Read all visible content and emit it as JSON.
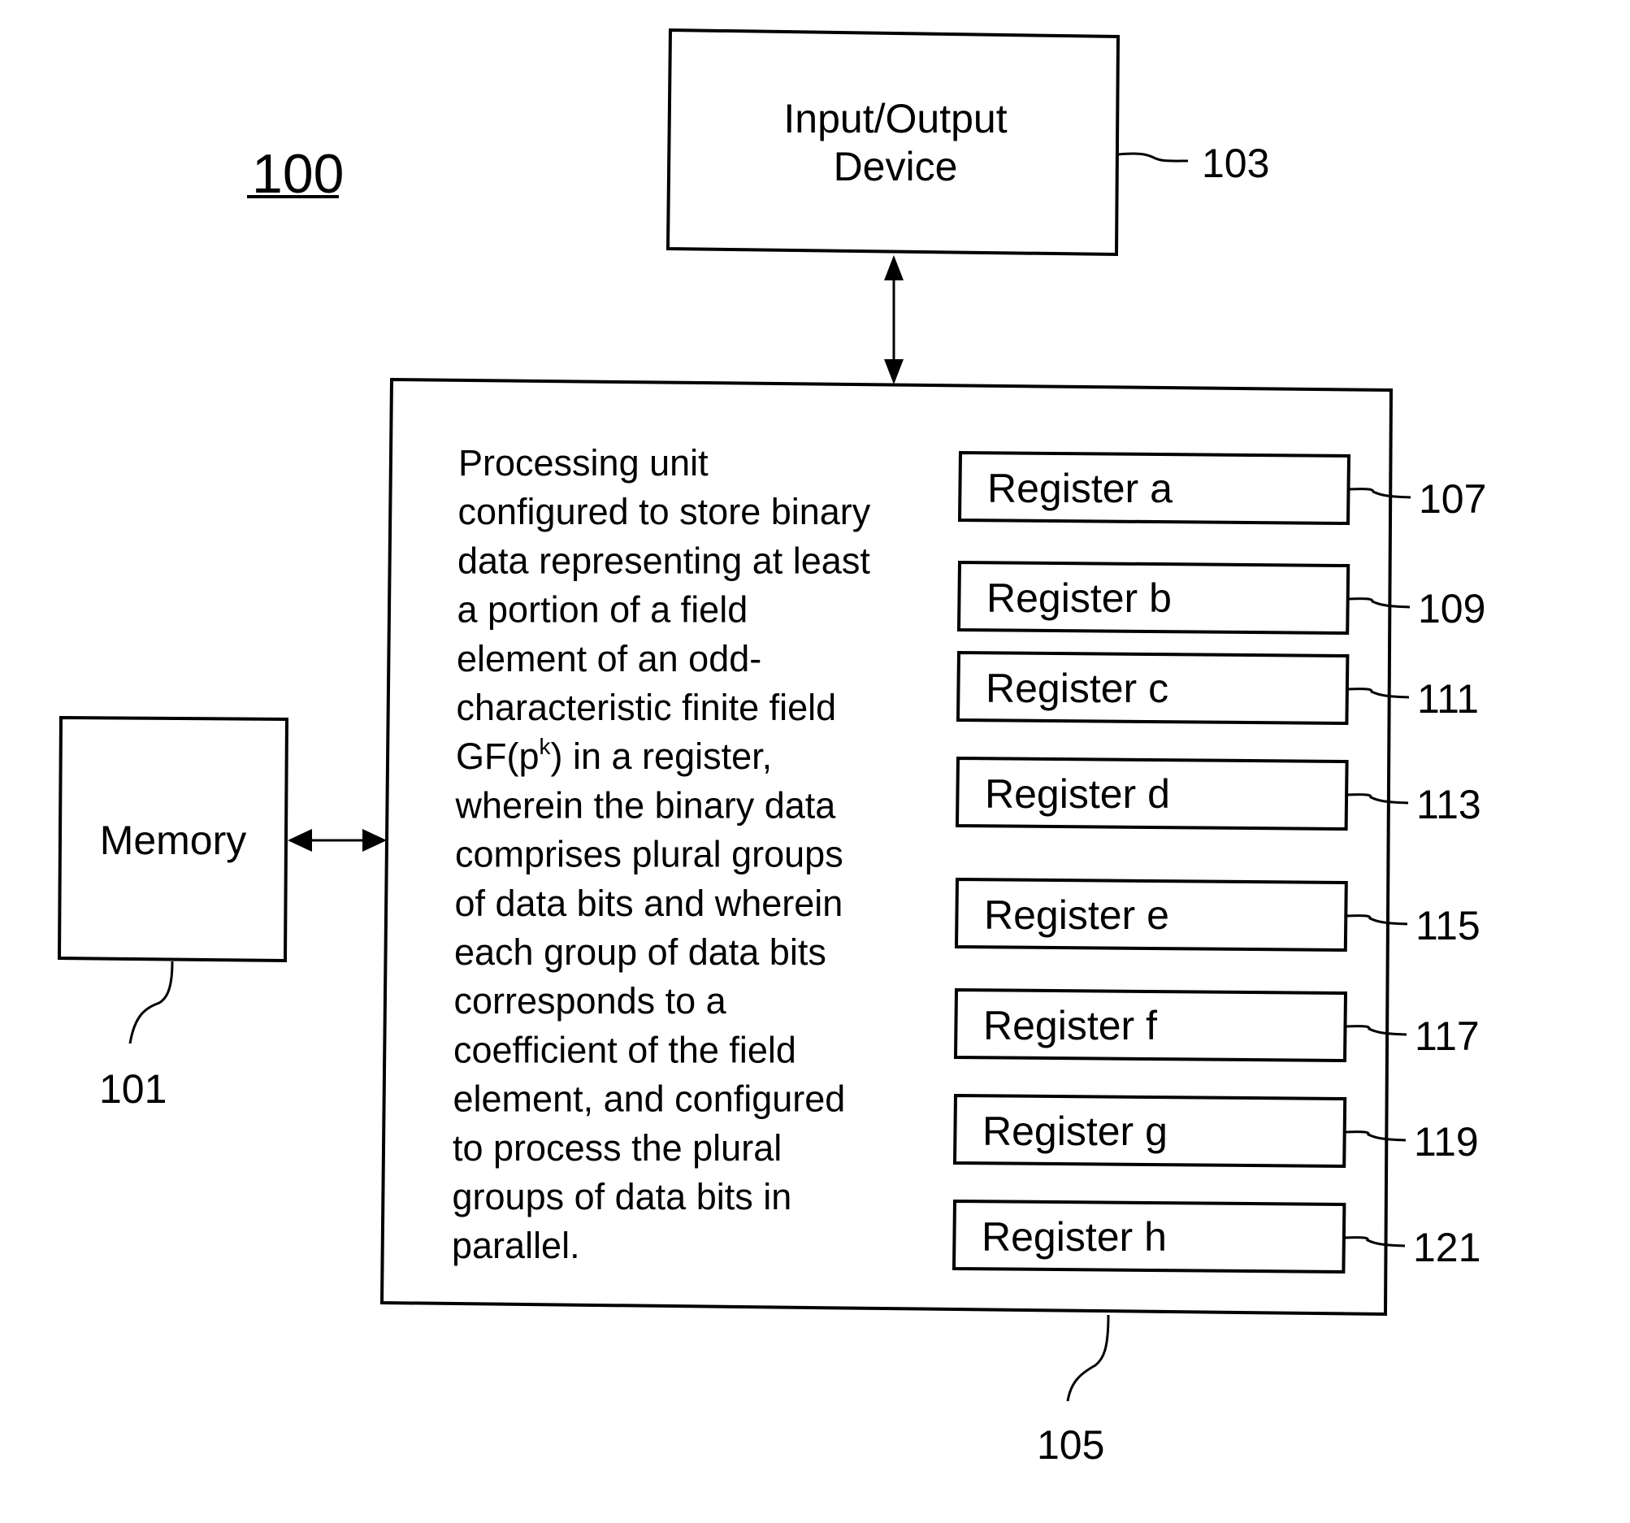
{
  "figure": {
    "number": "100"
  },
  "io_device": {
    "lines": [
      "Input/Output",
      "Device"
    ],
    "ref": "103"
  },
  "memory": {
    "label": "Memory",
    "ref": "101"
  },
  "processing_unit": {
    "ref": "105",
    "description_lines": [
      "Processing unit",
      "configured to store binary",
      "data representing at least",
      "a portion of a field",
      "element of an odd-",
      "characteristic finite field",
      "GF(p",
      "wherein the binary data",
      "comprises plural groups",
      "of data bits and wherein",
      "each group of data bits",
      "corresponds to a",
      "coefficient of the field",
      "element, and configured",
      "to process the plural",
      "groups of data bits in",
      "parallel."
    ],
    "gf_line": {
      "prefix": "GF(p",
      "superscript": "k",
      "suffix": ") in a register,"
    },
    "registers": [
      {
        "label": "Register a",
        "ref": "107"
      },
      {
        "label": "Register b",
        "ref": "109"
      },
      {
        "label": "Register c",
        "ref": "111"
      },
      {
        "label": "Register d",
        "ref": "113"
      },
      {
        "label": "Register e",
        "ref": "115"
      },
      {
        "label": "Register f",
        "ref": "117"
      },
      {
        "label": "Register g",
        "ref": "119"
      },
      {
        "label": "Register h",
        "ref": "121"
      }
    ]
  },
  "connections": [
    {
      "from": "memory",
      "to": "processing_unit",
      "type": "bidirectional"
    },
    {
      "from": "io_device",
      "to": "processing_unit",
      "type": "bidirectional"
    }
  ]
}
